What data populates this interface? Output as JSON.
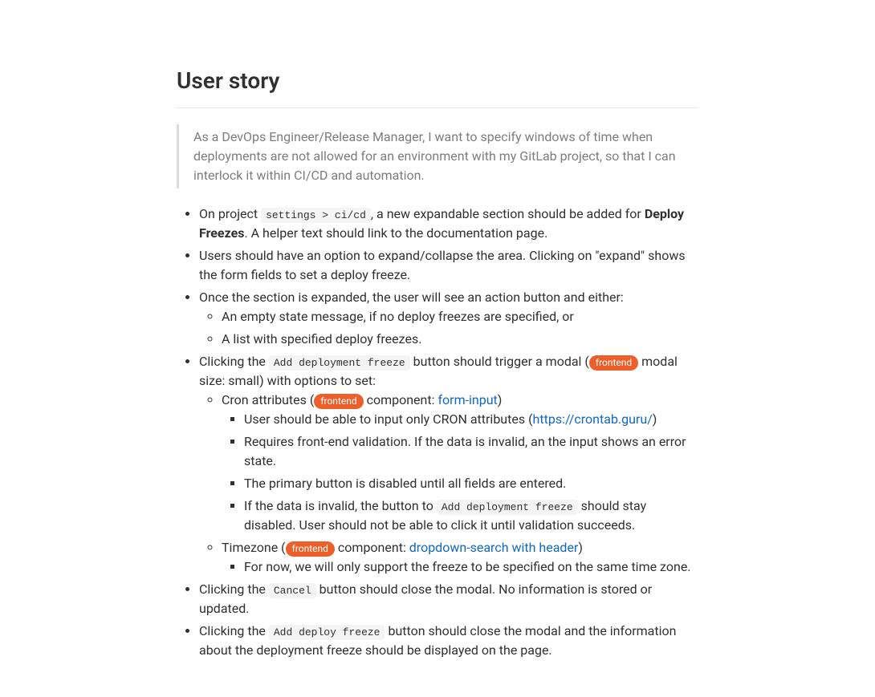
{
  "heading": "User story",
  "quote": "As a DevOps Engineer/Release Manager, I want to specify windows of time when deployments are not allowed for an environment with my GitLab project, so that I can interlock it within CI/CD and automation.",
  "labels": {
    "frontend": "frontend"
  },
  "txt": {
    "l1_pre": "On project ",
    "l1_code": "settings > ci/cd",
    "l1_mid": ", a new expandable section should be added for ",
    "l1_strong": "Deploy Freezes",
    "l1_post": ". A helper text should link to the documentation page.",
    "l2": "Users should have an option to expand/collapse the area. Clicking on \"expand\" shows the form fields to set a deploy freeze.",
    "l3": "Once the section is expanded, the user will see an action button and either:",
    "l3a": "An empty state message, if no deploy freezes are specified, or",
    "l3b": "A list with specified deploy freezes.",
    "l4_pre": "Clicking the ",
    "l4_code": "Add deployment freeze",
    "l4_mid": " button should trigger a modal (",
    "l4_post": " modal size: small) with options to set:",
    "l4a_pre": "Cron attributes (",
    "l4a_mid": " component: ",
    "l4a_link": "form-input",
    "l4a_post": ")",
    "l4a1_pre": "User should be able to input only CRON attributes (",
    "l4a1_link": "https://crontab.guru/",
    "l4a1_post": ")",
    "l4a2": "Requires front-end validation. If the data is invalid, an the input shows an error state.",
    "l4a3": "The primary button is disabled until all fields are entered.",
    "l4a4_pre": "If the data is invalid, the button to ",
    "l4a4_code": "Add deployment freeze",
    "l4a4_post": " should stay disabled. User should not be able to click it until validation succeeds.",
    "l4b_pre": "Timezone (",
    "l4b_mid": " component: ",
    "l4b_link": "dropdown-search with header",
    "l4b_post": ")",
    "l4b1": "For now, we will only support the freeze to be specified on the same time zone.",
    "l5_pre": "Clicking the ",
    "l5_code": "Cancel",
    "l5_post": " button should close the modal. No information is stored or updated.",
    "l6_pre": "Clicking the ",
    "l6_code": "Add deploy freeze",
    "l6_post": " button should close the modal and the information about the deployment freeze should be displayed on the page."
  },
  "links": {
    "formInput": "#",
    "crontab": "https://crontab.guru/",
    "dropdown": "#"
  }
}
